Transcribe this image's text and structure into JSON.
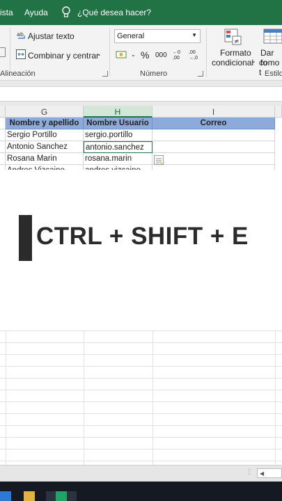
{
  "menu": {
    "items": [
      "ista",
      "Ayuda"
    ],
    "search_label": "¿Qué desea hacer?"
  },
  "ribbon": {
    "wrap_text": "Ajustar texto",
    "merge_center": "Combinar y centrar",
    "alignment_group": "Alineación",
    "number_format": "General",
    "percent_symbol": "%",
    "thousands_symbol": "000",
    "increase_decimals": "←0 ,00",
    "decrease_decimals": ",00 →,0",
    "number_group": "Número",
    "conditional_format_line1": "Formato",
    "conditional_format_line2": "condicional",
    "format_table_line1": "Dar fo",
    "format_table_line2": "como t",
    "styles_group": "Estilos"
  },
  "sheet": {
    "columns": [
      "G",
      "H",
      "I"
    ],
    "selected_column": "H",
    "headers": [
      "Nombre y apellido",
      "Nombre Usuario",
      "Correo"
    ],
    "rows": [
      [
        "Sergio Portillo",
        "sergio.portillo",
        ""
      ],
      [
        "Antonio Sanchez",
        "antonio.sanchez",
        ""
      ],
      [
        "Rosana Marin",
        "rosana.marin",
        ""
      ],
      [
        "Andres Vizcaino",
        "andres.vizcaino",
        ""
      ]
    ],
    "header_fill": "#8ea9db"
  },
  "overlay": {
    "shortcut_text": "CTRL + SHIFT + E"
  },
  "colors": {
    "excel_green": "#217346",
    "taskbar": "#151a22"
  }
}
